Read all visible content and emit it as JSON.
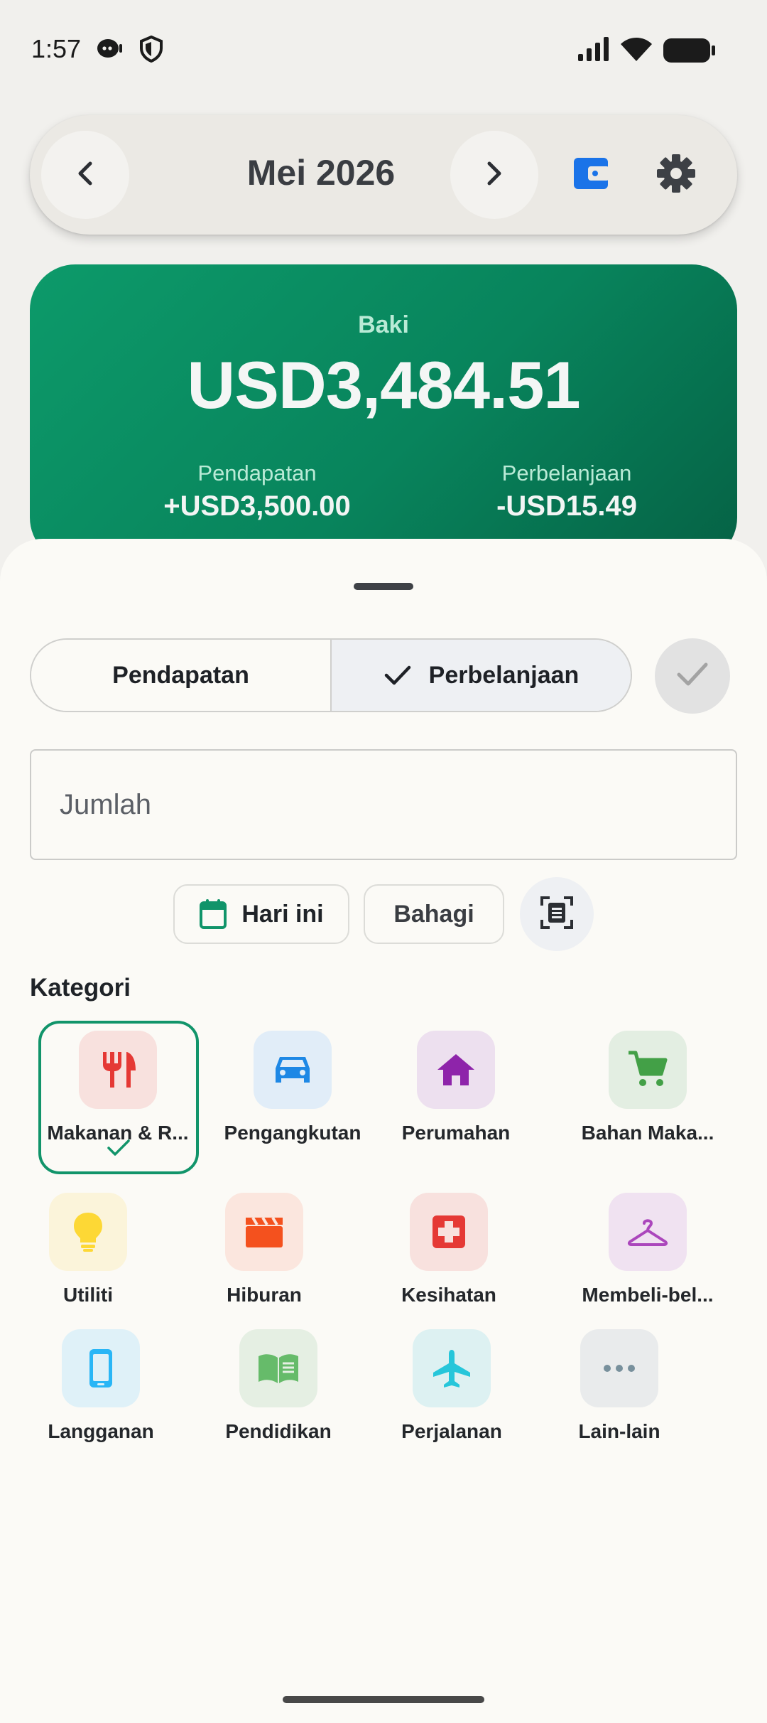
{
  "status_bar": {
    "time": "1:57"
  },
  "header": {
    "month": "Mei 2026",
    "prev_icon": "chevron-left-icon",
    "next_icon": "chevron-right-icon",
    "wallet_icon": "wallet-icon",
    "settings_icon": "gear-icon",
    "accent_color": "#1a73e8"
  },
  "balance": {
    "label": "Baki",
    "amount": "USD3,484.51",
    "income_label": "Pendapatan",
    "income_value": "+USD3,500.00",
    "expense_label": "Perbelanjaan",
    "expense_value": "-USD15.49",
    "card_color": "#0a8f63"
  },
  "form": {
    "type_tabs": [
      {
        "label": "Pendapatan",
        "selected": false
      },
      {
        "label": "Perbelanjaan",
        "selected": true
      }
    ],
    "amount_placeholder": "Jumlah",
    "date_chip": "Hari ini",
    "split_chip": "Bahagi",
    "scan_icon": "receipt-scan-icon"
  },
  "categories": {
    "title": "Kategori",
    "selected_index": 0,
    "items": [
      {
        "label": "Makanan & R...",
        "icon": "utensils-icon",
        "color": "#e53935",
        "bg": "#f8e1de"
      },
      {
        "label": "Pengangkutan",
        "icon": "car-icon",
        "color": "#1e88e5",
        "bg": "#e1edf8"
      },
      {
        "label": "Perumahan",
        "icon": "house-icon",
        "color": "#8e24aa",
        "bg": "#ede0ef"
      },
      {
        "label": "Bahan Maka...",
        "icon": "cart-icon",
        "color": "#43a047",
        "bg": "#e3eee2"
      },
      {
        "label": "Utiliti",
        "icon": "lightbulb-icon",
        "color": "#fdd835",
        "bg": "#fbf4da"
      },
      {
        "label": "Hiburan",
        "icon": "clapperboard-icon",
        "color": "#f4511e",
        "bg": "#fbe6de"
      },
      {
        "label": "Kesihatan",
        "icon": "medical-cross-icon",
        "color": "#e53935",
        "bg": "#f8e1de"
      },
      {
        "label": "Membeli-bel...",
        "icon": "hanger-icon",
        "color": "#ab47bc",
        "bg": "#f0e2f1"
      },
      {
        "label": "Langganan",
        "icon": "phone-icon",
        "color": "#29b6f6",
        "bg": "#dff1f8"
      },
      {
        "label": "Pendidikan",
        "icon": "book-icon",
        "color": "#66bb6a",
        "bg": "#e5efe3"
      },
      {
        "label": "Perjalanan",
        "icon": "airplane-icon",
        "color": "#26c6da",
        "bg": "#ddf1f2"
      },
      {
        "label": "Lain-lain",
        "icon": "more-dots-icon",
        "color": "#78909c",
        "bg": "#e9ebec"
      }
    ]
  }
}
